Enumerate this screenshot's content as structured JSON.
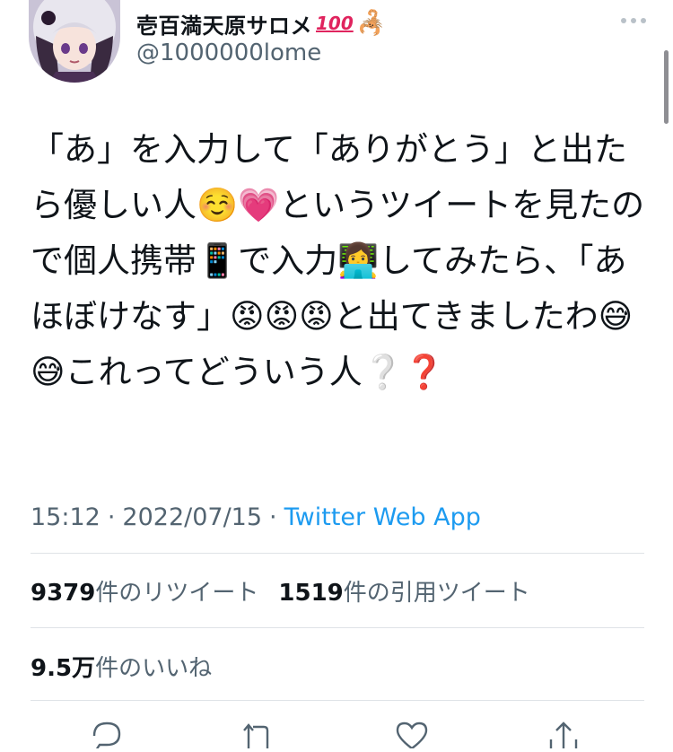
{
  "author": {
    "display_name": "壱百満天原サロメ",
    "badge_hundred": "100",
    "badge_emoji": "🦂",
    "handle": "@1000000lome"
  },
  "tweet": {
    "text": "「あ」を入力して「ありがとう」と出たら優しい人☺️💗というツイートを見たので個人携帯📱で入力👩‍💻してみたら、「あほぼけなす」😡😡😡と出てきましたわ😅😅これってどういう人❔❓"
  },
  "meta": {
    "time": "15:12",
    "separator": "·",
    "date": "2022/07/15",
    "source": "Twitter Web App"
  },
  "stats": {
    "retweets_count": "9379",
    "retweets_label": "件のリツイート",
    "quotes_count": "1519",
    "quotes_label": "件の引用ツイート",
    "likes_count": "9.5万",
    "likes_label": "件のいいね"
  },
  "icons": {
    "more": "more-icon",
    "reply": "reply-icon",
    "retweet": "retweet-icon",
    "like": "like-icon",
    "share": "share-icon"
  },
  "colors": {
    "link": "#1d9bf0",
    "secondary_text": "#536471",
    "primary_text": "#0f1419",
    "divider": "#dfe3e7"
  }
}
